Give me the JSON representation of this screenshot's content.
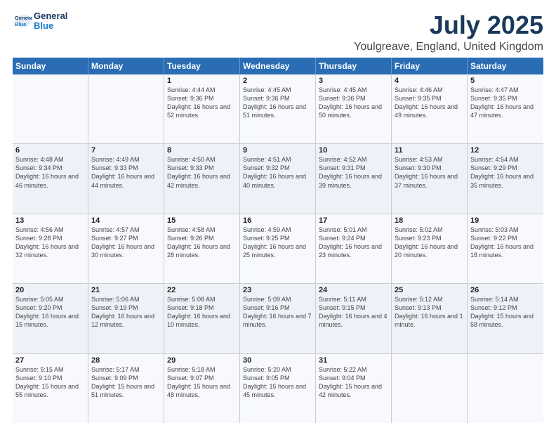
{
  "logo": {
    "line1": "General",
    "line2": "Blue"
  },
  "title": "July 2025",
  "subtitle": "Youlgreave, England, United Kingdom",
  "days_of_week": [
    "Sunday",
    "Monday",
    "Tuesday",
    "Wednesday",
    "Thursday",
    "Friday",
    "Saturday"
  ],
  "weeks": [
    [
      {
        "day": "",
        "sunrise": "",
        "sunset": "",
        "daylight": ""
      },
      {
        "day": "",
        "sunrise": "",
        "sunset": "",
        "daylight": ""
      },
      {
        "day": "1",
        "sunrise": "Sunrise: 4:44 AM",
        "sunset": "Sunset: 9:36 PM",
        "daylight": "Daylight: 16 hours and 52 minutes."
      },
      {
        "day": "2",
        "sunrise": "Sunrise: 4:45 AM",
        "sunset": "Sunset: 9:36 PM",
        "daylight": "Daylight: 16 hours and 51 minutes."
      },
      {
        "day": "3",
        "sunrise": "Sunrise: 4:45 AM",
        "sunset": "Sunset: 9:36 PM",
        "daylight": "Daylight: 16 hours and 50 minutes."
      },
      {
        "day": "4",
        "sunrise": "Sunrise: 4:46 AM",
        "sunset": "Sunset: 9:35 PM",
        "daylight": "Daylight: 16 hours and 49 minutes."
      },
      {
        "day": "5",
        "sunrise": "Sunrise: 4:47 AM",
        "sunset": "Sunset: 9:35 PM",
        "daylight": "Daylight: 16 hours and 47 minutes."
      }
    ],
    [
      {
        "day": "6",
        "sunrise": "Sunrise: 4:48 AM",
        "sunset": "Sunset: 9:34 PM",
        "daylight": "Daylight: 16 hours and 46 minutes."
      },
      {
        "day": "7",
        "sunrise": "Sunrise: 4:49 AM",
        "sunset": "Sunset: 9:33 PM",
        "daylight": "Daylight: 16 hours and 44 minutes."
      },
      {
        "day": "8",
        "sunrise": "Sunrise: 4:50 AM",
        "sunset": "Sunset: 9:33 PM",
        "daylight": "Daylight: 16 hours and 42 minutes."
      },
      {
        "day": "9",
        "sunrise": "Sunrise: 4:51 AM",
        "sunset": "Sunset: 9:32 PM",
        "daylight": "Daylight: 16 hours and 40 minutes."
      },
      {
        "day": "10",
        "sunrise": "Sunrise: 4:52 AM",
        "sunset": "Sunset: 9:31 PM",
        "daylight": "Daylight: 16 hours and 39 minutes."
      },
      {
        "day": "11",
        "sunrise": "Sunrise: 4:53 AM",
        "sunset": "Sunset: 9:30 PM",
        "daylight": "Daylight: 16 hours and 37 minutes."
      },
      {
        "day": "12",
        "sunrise": "Sunrise: 4:54 AM",
        "sunset": "Sunset: 9:29 PM",
        "daylight": "Daylight: 16 hours and 35 minutes."
      }
    ],
    [
      {
        "day": "13",
        "sunrise": "Sunrise: 4:56 AM",
        "sunset": "Sunset: 9:28 PM",
        "daylight": "Daylight: 16 hours and 32 minutes."
      },
      {
        "day": "14",
        "sunrise": "Sunrise: 4:57 AM",
        "sunset": "Sunset: 9:27 PM",
        "daylight": "Daylight: 16 hours and 30 minutes."
      },
      {
        "day": "15",
        "sunrise": "Sunrise: 4:58 AM",
        "sunset": "Sunset: 9:26 PM",
        "daylight": "Daylight: 16 hours and 28 minutes."
      },
      {
        "day": "16",
        "sunrise": "Sunrise: 4:59 AM",
        "sunset": "Sunset: 9:25 PM",
        "daylight": "Daylight: 16 hours and 25 minutes."
      },
      {
        "day": "17",
        "sunrise": "Sunrise: 5:01 AM",
        "sunset": "Sunset: 9:24 PM",
        "daylight": "Daylight: 16 hours and 23 minutes."
      },
      {
        "day": "18",
        "sunrise": "Sunrise: 5:02 AM",
        "sunset": "Sunset: 9:23 PM",
        "daylight": "Daylight: 16 hours and 20 minutes."
      },
      {
        "day": "19",
        "sunrise": "Sunrise: 5:03 AM",
        "sunset": "Sunset: 9:22 PM",
        "daylight": "Daylight: 16 hours and 18 minutes."
      }
    ],
    [
      {
        "day": "20",
        "sunrise": "Sunrise: 5:05 AM",
        "sunset": "Sunset: 9:20 PM",
        "daylight": "Daylight: 16 hours and 15 minutes."
      },
      {
        "day": "21",
        "sunrise": "Sunrise: 5:06 AM",
        "sunset": "Sunset: 9:19 PM",
        "daylight": "Daylight: 16 hours and 12 minutes."
      },
      {
        "day": "22",
        "sunrise": "Sunrise: 5:08 AM",
        "sunset": "Sunset: 9:18 PM",
        "daylight": "Daylight: 16 hours and 10 minutes."
      },
      {
        "day": "23",
        "sunrise": "Sunrise: 5:09 AM",
        "sunset": "Sunset: 9:16 PM",
        "daylight": "Daylight: 16 hours and 7 minutes."
      },
      {
        "day": "24",
        "sunrise": "Sunrise: 5:11 AM",
        "sunset": "Sunset: 9:15 PM",
        "daylight": "Daylight: 16 hours and 4 minutes."
      },
      {
        "day": "25",
        "sunrise": "Sunrise: 5:12 AM",
        "sunset": "Sunset: 9:13 PM",
        "daylight": "Daylight: 16 hours and 1 minute."
      },
      {
        "day": "26",
        "sunrise": "Sunrise: 5:14 AM",
        "sunset": "Sunset: 9:12 PM",
        "daylight": "Daylight: 15 hours and 58 minutes."
      }
    ],
    [
      {
        "day": "27",
        "sunrise": "Sunrise: 5:15 AM",
        "sunset": "Sunset: 9:10 PM",
        "daylight": "Daylight: 15 hours and 55 minutes."
      },
      {
        "day": "28",
        "sunrise": "Sunrise: 5:17 AM",
        "sunset": "Sunset: 9:09 PM",
        "daylight": "Daylight: 15 hours and 51 minutes."
      },
      {
        "day": "29",
        "sunrise": "Sunrise: 5:18 AM",
        "sunset": "Sunset: 9:07 PM",
        "daylight": "Daylight: 15 hours and 48 minutes."
      },
      {
        "day": "30",
        "sunrise": "Sunrise: 5:20 AM",
        "sunset": "Sunset: 9:05 PM",
        "daylight": "Daylight: 15 hours and 45 minutes."
      },
      {
        "day": "31",
        "sunrise": "Sunrise: 5:22 AM",
        "sunset": "Sunset: 9:04 PM",
        "daylight": "Daylight: 15 hours and 42 minutes."
      },
      {
        "day": "",
        "sunrise": "",
        "sunset": "",
        "daylight": ""
      },
      {
        "day": "",
        "sunrise": "",
        "sunset": "",
        "daylight": ""
      }
    ]
  ]
}
